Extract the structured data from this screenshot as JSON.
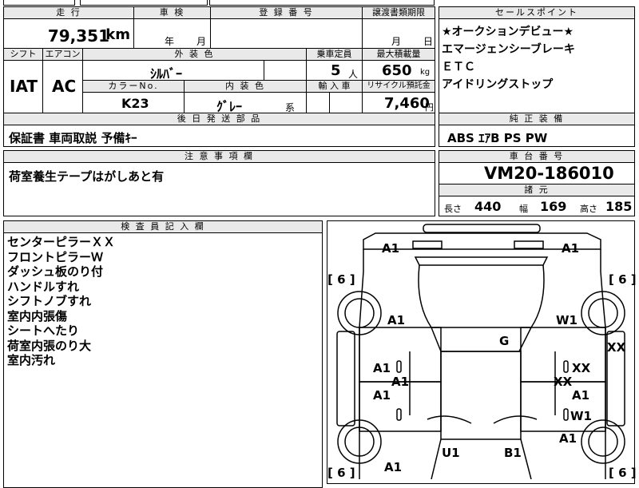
{
  "top_fragment": "",
  "mileage": {
    "header": "走 行",
    "value": "79,351",
    "unit": "km"
  },
  "inspection": {
    "header": "車 検",
    "year": "年",
    "month": "月"
  },
  "registration": {
    "header": "登 録 番 号",
    "value": ""
  },
  "transfer": {
    "header": "譲渡書類期限",
    "month": "月",
    "day": "日"
  },
  "shift": {
    "header": "シフト",
    "value": "IAT"
  },
  "aircon": {
    "header": "エアコン",
    "value": "AC"
  },
  "exterior": {
    "header": "外 装 色",
    "value": "ｼﾙﾊﾞｰ"
  },
  "capacity": {
    "header": "乗車定員",
    "value": "5",
    "unit": "人"
  },
  "max_load": {
    "header": "最大積載量",
    "value": "650",
    "unit": "kg"
  },
  "color_no": {
    "header": "カラーNo.",
    "value": "K23"
  },
  "interior": {
    "header": "内 装 色",
    "value": "ｸﾞﾚｰ",
    "suffix": "系"
  },
  "import": {
    "header": "輸 入 車",
    "value": ""
  },
  "recycle": {
    "header": "リサイクル預託金",
    "value": "7,460",
    "unit": "円"
  },
  "sales_points": {
    "header": "セールスポイント",
    "items": [
      "★オークションデビュー★",
      "エマージェンシーブレーキ",
      "ＥＴＣ",
      "アイドリングストップ"
    ]
  },
  "later_parts": {
    "header": "後 日 発 送 部 品",
    "value": "保証書 車両取説 予備ｷｰ"
  },
  "equipment": {
    "header": "純 正 装 備",
    "value": "ABS ｴｱB PS PW"
  },
  "notes": {
    "header": "注 意 事 項 欄",
    "value": "荷室養生テープはがしあと有"
  },
  "chassis": {
    "header": "車 台 番 号",
    "value": "VM20-186010"
  },
  "specs": {
    "header": "諸 元",
    "length_label": "長さ",
    "length": "440",
    "width_label": "幅",
    "width": "169",
    "height_label": "高さ",
    "height": "185"
  },
  "inspector": {
    "header": "検 査 員 記 入 欄",
    "items": [
      "センターピラーＸＸ",
      "フロントピラーＷ",
      "ダッシュ板のり付",
      "ハンドルすれ",
      "シフトノブすれ",
      "室内内張傷",
      "シートへたり",
      "荷室内張のり大",
      "室内汚れ"
    ]
  },
  "diagram": {
    "tire_left_top": "6",
    "tire_right_top": "6",
    "tire_left_bottom": "6",
    "tire_right_bottom": "6",
    "marks": {
      "a1_tl": "A1",
      "a1_tr": "A1",
      "a1_lf": "A1",
      "w1_rf": "W1",
      "g_hood": "G",
      "xx_rf": "XX",
      "a1_ld1": "A1",
      "a1_ld1b": "A1",
      "xx_rd1": "XX",
      "xx_rd1b": "XX",
      "a1_ld2": "A1",
      "a1_rd2": "A1",
      "w1_rd2": "W1",
      "a1_rr": "A1",
      "u1": "U1",
      "b1": "B1",
      "a1_bl": "A1"
    }
  }
}
